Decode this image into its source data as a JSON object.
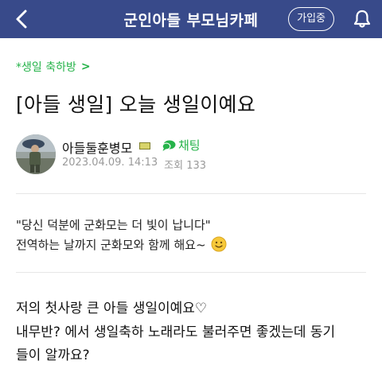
{
  "header": {
    "title": "군인아들 부모님카페",
    "join_label": "가입중",
    "back_icon": "chevron-left-icon",
    "bell_icon": "bell-icon",
    "bg_color": "#384a8a"
  },
  "board": {
    "label": "*생일 축하방",
    "chevron": ">",
    "color": "#26b34a"
  },
  "post": {
    "title": "[아들 생일] 오늘 생일이예요",
    "author": {
      "name": "아들둘훈병모",
      "chat_label": "채팅",
      "date": "2023.04.09. 14:13",
      "views_label": "조회",
      "views": "133"
    },
    "quote_lines": [
      "\"당신 덕분에 군화모는 더 빛이 납니다\"",
      "전역하는 날까지 군화모와 함께 해요~"
    ],
    "body_lines": [
      "저의 첫사랑 큰 아들 생일이예요♡",
      "내무반? 에서 생일축하 노래라도 불러주면 좋겠는데 동기",
      "들이 알까요?"
    ]
  }
}
